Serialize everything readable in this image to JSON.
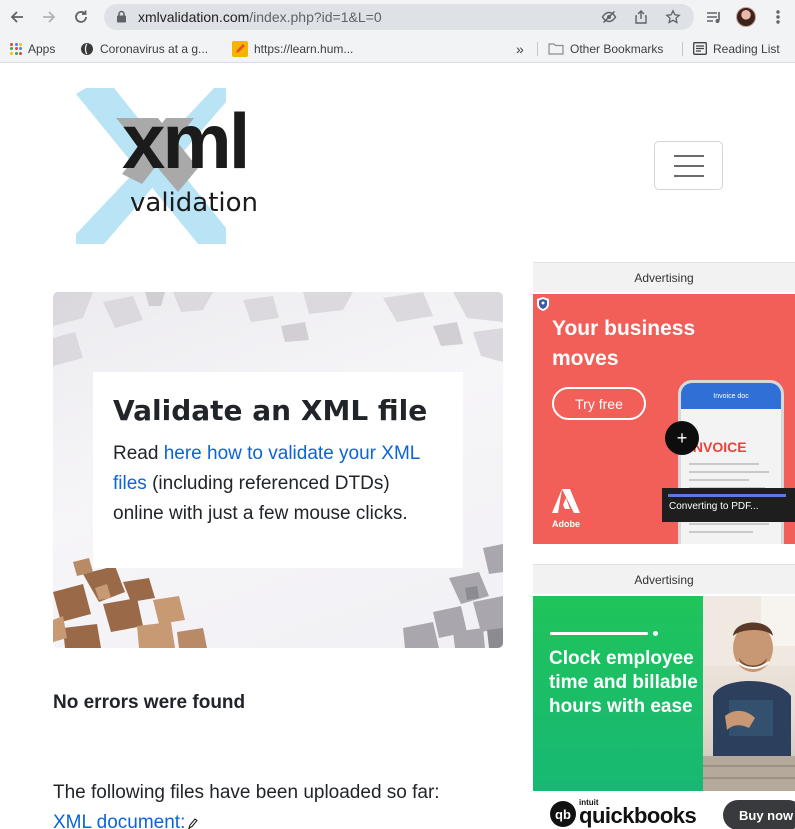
{
  "browser": {
    "url_host": "xmlvalidation.com",
    "url_path": "/index.php?id=1&L=0",
    "bookmarks": [
      {
        "label": "Apps",
        "icon": "apps-grid-icon"
      },
      {
        "label": "Coronavirus at a g...",
        "icon": "coronavirus-icon"
      },
      {
        "label": "https://learn.hum...",
        "icon": "pencil-icon"
      }
    ],
    "overflow_label": "»",
    "other_bookmarks": "Other Bookmarks",
    "reading_list": "Reading List"
  },
  "site": {
    "logo_main": "xml",
    "logo_sub": "validation"
  },
  "hero": {
    "title": "Validate an XML file",
    "body_prefix": "Read ",
    "body_link": "here how to validate your XML files",
    "body_suffix": " (including referenced DTDs) online with just a few mouse clicks."
  },
  "results": {
    "status": "No errors were found",
    "uploaded_heading": "The following files have been uploaded so far:",
    "file_link": "XML document:"
  },
  "ads": {
    "label": "Advertising",
    "adobe": {
      "headline": "Your business moves",
      "cta": "Try free",
      "phone_header": "Invoice doc",
      "invoice": "INVOICE",
      "converting": "Converting to PDF...",
      "brand": "Adobe",
      "accent": "#f25f58"
    },
    "quickbooks": {
      "copy": "Clock employee time and billable hours with ease",
      "intuit": "intuit",
      "brand": "quickbooks",
      "cta": "Buy now",
      "accent": "#1fc45a"
    }
  },
  "colors": {
    "link": "#0b64d9",
    "logo_cross_light": "#b9e4f6",
    "logo_cross_gray": "#a9a9a9"
  }
}
